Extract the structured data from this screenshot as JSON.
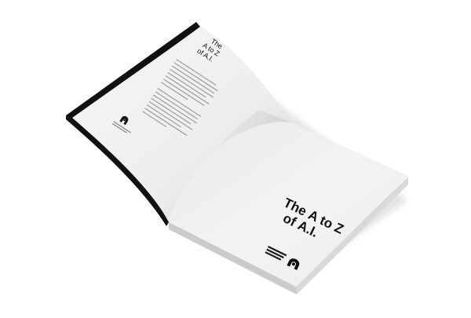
{
  "book": {
    "left_page": {
      "title_line1": "The",
      "title_line2": "A to Z",
      "title_line3": "of A.I."
    },
    "right_page": {
      "title_line1_regular": "The ",
      "title_line1_bold": "A to Z",
      "title_line2_regular": "of ",
      "title_line2_bold": "A.I."
    }
  },
  "colors": {
    "background": "#ffffff",
    "paper": "#f2f2f2",
    "paper_shadow": "#dadada",
    "cover_black": "#111111",
    "text": "#111111"
  },
  "icons": [
    "publisher-logo-icon"
  ]
}
